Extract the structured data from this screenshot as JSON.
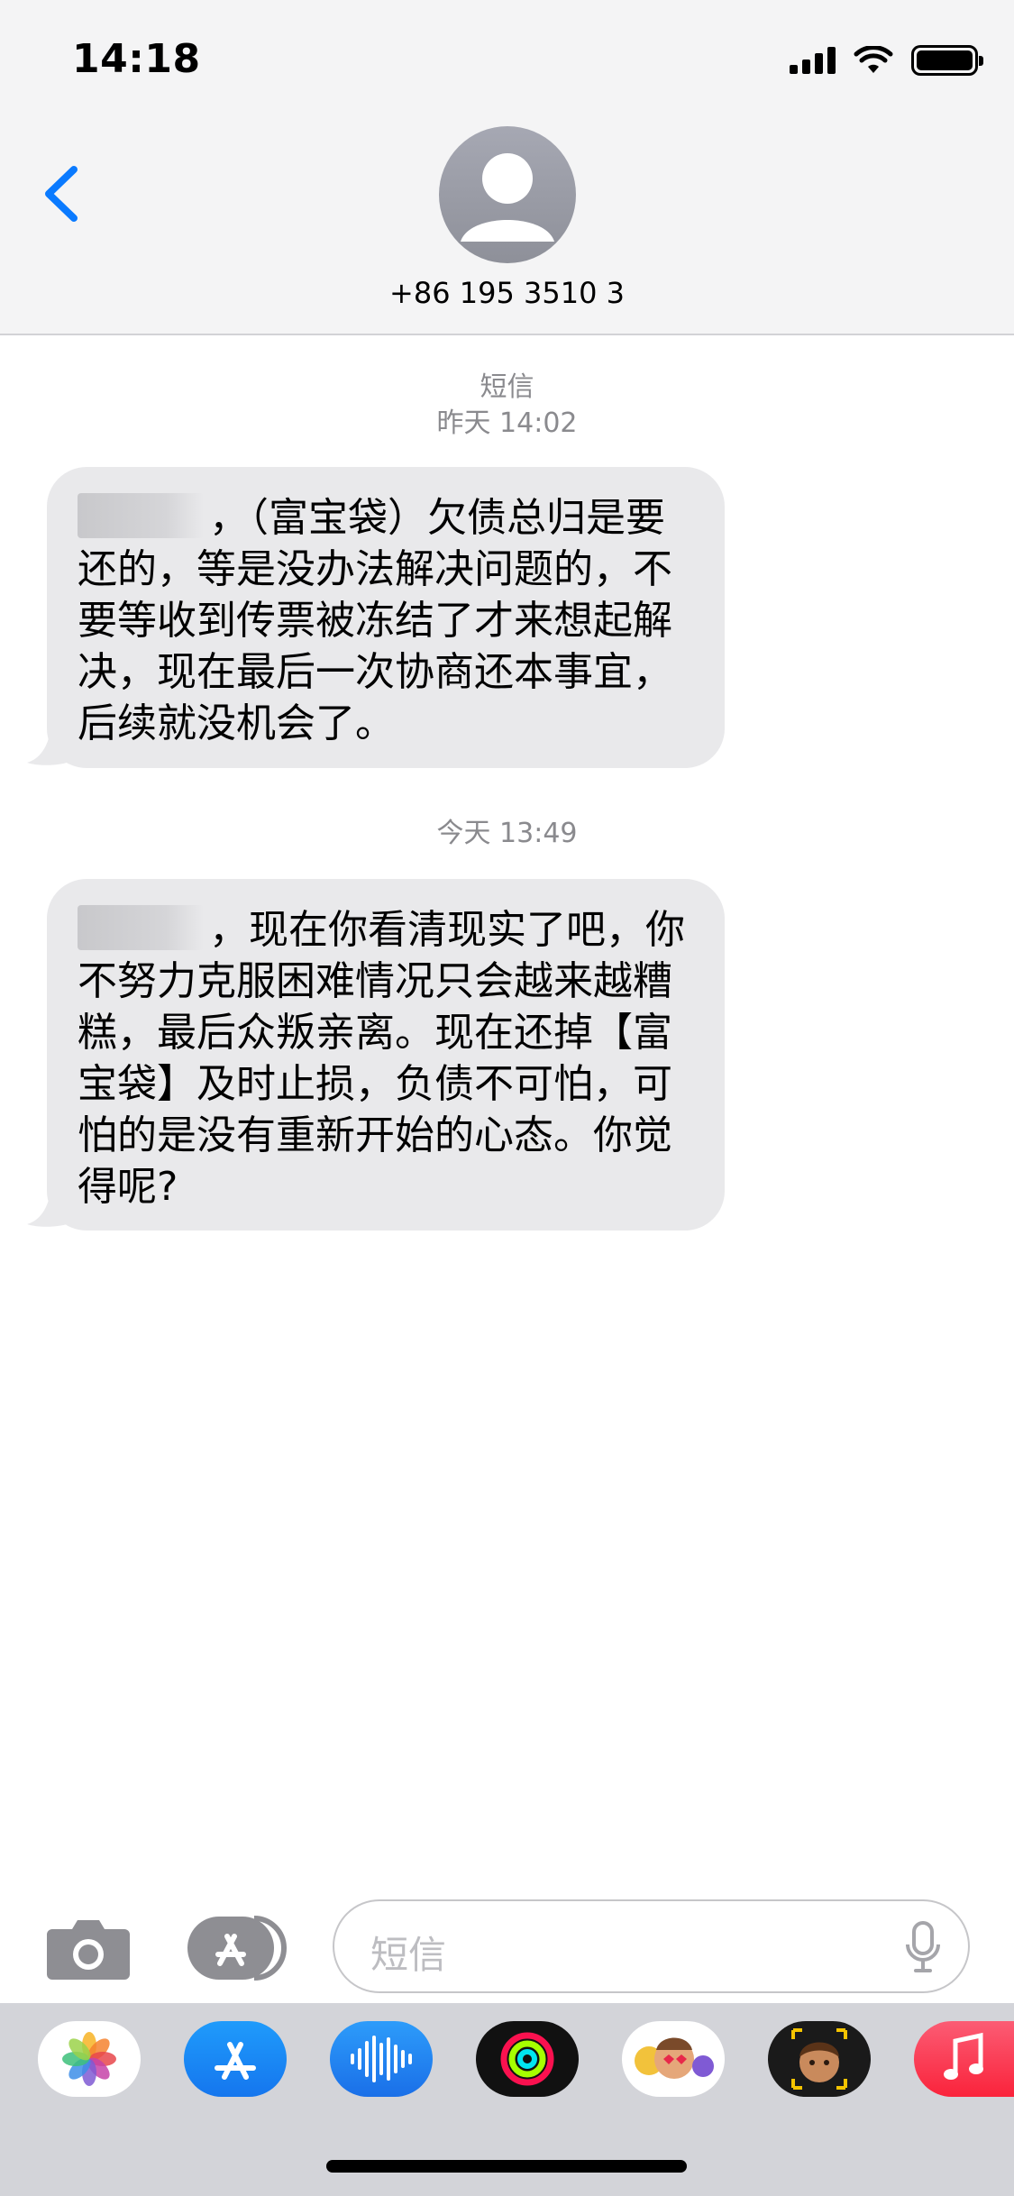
{
  "status_bar": {
    "time": "14:18"
  },
  "header": {
    "contact": "+86 195 3510 3"
  },
  "conversation": {
    "messages": [
      {
        "service": "短信",
        "timestamp": "昨天 14:02",
        "text": "，（富宝袋）欠债总归是要还的，等是没办法解决问题的，不要等收到传票被冻结了才来想起解决，现在最后一次协商还本事宜，后续就没机会了。"
      },
      {
        "timestamp": "今天 13:49",
        "text": "，现在你看清现实了吧，你不努力克服困难情况只会越来越糟糕，最后众叛亲离。现在还掉【富宝袋】及时止损，负债不可怕，可怕的是没有重新开始的心态。你觉得呢?"
      }
    ]
  },
  "input": {
    "placeholder": "短信"
  },
  "app_drawer": {
    "apps": [
      "photos-icon",
      "app-store-icon",
      "audio-messages-icon",
      "fitness-icon",
      "memoji-stickers-icon",
      "memoji-icon",
      "music-icon"
    ]
  },
  "colors": {
    "accent": "#0a7aff",
    "bubble": "#e9e9eb",
    "header": "#f4f4f5",
    "drawer": "#d3d4d9"
  }
}
